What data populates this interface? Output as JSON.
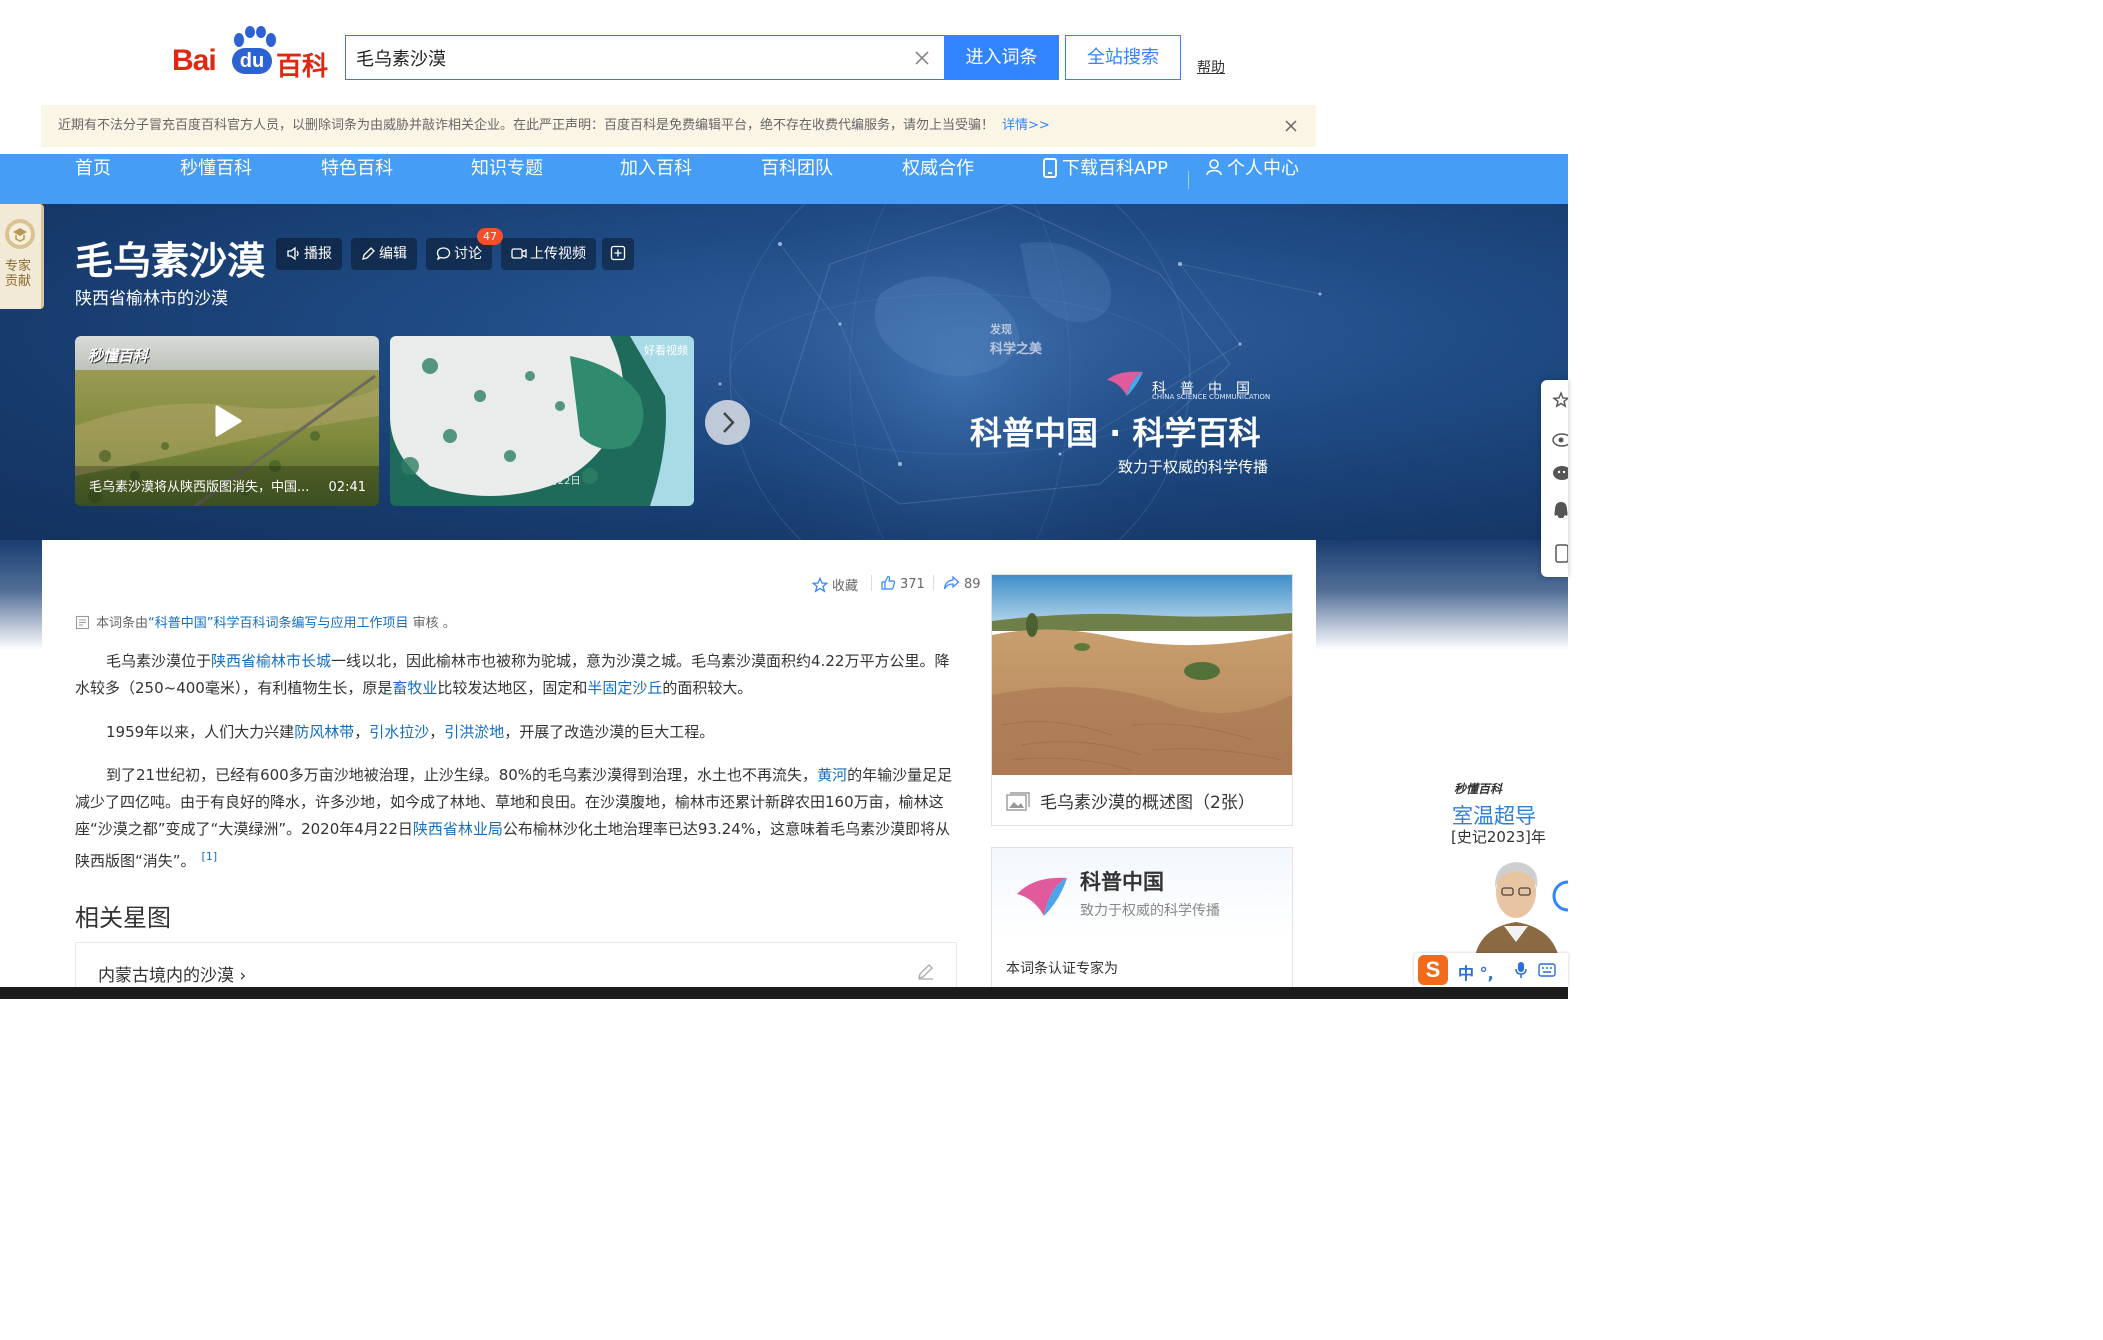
{
  "header": {
    "logo_text_bai": "Bai",
    "logo_text_du": "du",
    "logo_text_baike": "百科",
    "search_value": "毛乌素沙漠",
    "enter_button": "进入词条",
    "site_search_button": "全站搜索",
    "help_link": "帮助"
  },
  "notice": {
    "text": "近期有不法分子冒充百度百科官方人员，以删除词条为由威胁并敲诈相关企业。在此严正声明：百度百科是免费编辑平台，绝不存在收费代编服务，请勿上当受骗！",
    "detail_link": "详情>>"
  },
  "nav": {
    "items": [
      "首页",
      "秒懂百科",
      "特色百科",
      "知识专题",
      "加入百科",
      "百科团队",
      "权威合作"
    ],
    "download_app": "下载百科APP",
    "user_center": "个人中心"
  },
  "expert_tab": {
    "label": "专家贡献"
  },
  "entry": {
    "title": "毛乌素沙漠",
    "subtitle": "陕西省榆林市的沙漠",
    "tools": {
      "play": "播报",
      "edit": "编辑",
      "discuss": "讨论",
      "discuss_count": "47",
      "upload_video": "上传视频"
    }
  },
  "videos": [
    {
      "brand": "秒懂百科",
      "title": "毛乌素沙漠将从陕西版图消失，中国...",
      "duration": "02:41"
    },
    {
      "brand": "好看视频",
      "date": "2020年4月22日"
    }
  ],
  "banner": {
    "discover_line1": "发现",
    "discover_line2": "科学之美",
    "org_cn": "科普中国",
    "org_en": "CHINA SCIENCE COMMUNICATION",
    "slogan": "科普中国 · 科学百科",
    "sub": "致力于权威的科学传播"
  },
  "actions": {
    "favorite": "收藏",
    "likes": "371",
    "shares": "89"
  },
  "review_note": {
    "prefix": "本词条由",
    "link": "“科普中国”科学百科词条编写与应用工作项目",
    "suffix": " 审核 。"
  },
  "paragraphs": {
    "p1": {
      "t1": "毛乌素沙漠位于",
      "l1": "陕西省榆林市",
      "l2": "长城",
      "t2": "一线以北，因此榆林市也被称为驼城，意为沙漠之城。毛乌素沙漠面积约4.22万平方公里。降水较多（250~400毫米），有利植物生长，原是",
      "l3": "畜牧业",
      "t3": "比较发达地区，固定和",
      "l4": "半固定沙丘",
      "t4": "的面积较大。"
    },
    "p2": {
      "t1": "1959年以来，人们大力兴建",
      "l1": "防风林带",
      "s1": "，",
      "l2": "引水拉沙",
      "s2": "，",
      "l3": "引洪淤地",
      "t2": "，开展了改造沙漠的巨大工程。"
    },
    "p3": {
      "t1": "到了21世纪初，已经有600多万亩沙地被治理，止沙生绿。80%的毛乌素沙漠得到治理，水土也不再流失，",
      "l1": "黄河",
      "t2": "的年输沙量足足减少了四亿吨。由于有良好的降水，许多沙地，如今成了林地、草地和良田。在沙漠腹地，榆林市还累计新辟农田160万亩，榆林这座“沙漠之都”变成了“大漠绿洲”。2020年4月22日",
      "l2": "陕西省林业局",
      "t3": "公布榆林沙化土地治理率已达93.24%，这意味着毛乌素沙漠即将从陕西版图“消失”。",
      "ref": "[1]"
    }
  },
  "related": {
    "title": "相关星图",
    "link": "内蒙古境内的沙漠 ›"
  },
  "sidebar": {
    "image_caption": "毛乌素沙漠的概述图（2张）",
    "kp_title": "科普中国",
    "kp_sub": "致力于权威的科学传播",
    "kp_expert": "本词条认证专家为"
  },
  "promo": {
    "brand": "秒懂百科",
    "title": "室温超导",
    "sub": "[史记2023]年"
  },
  "ime": {
    "logo": "S",
    "lang": "中 °,"
  }
}
